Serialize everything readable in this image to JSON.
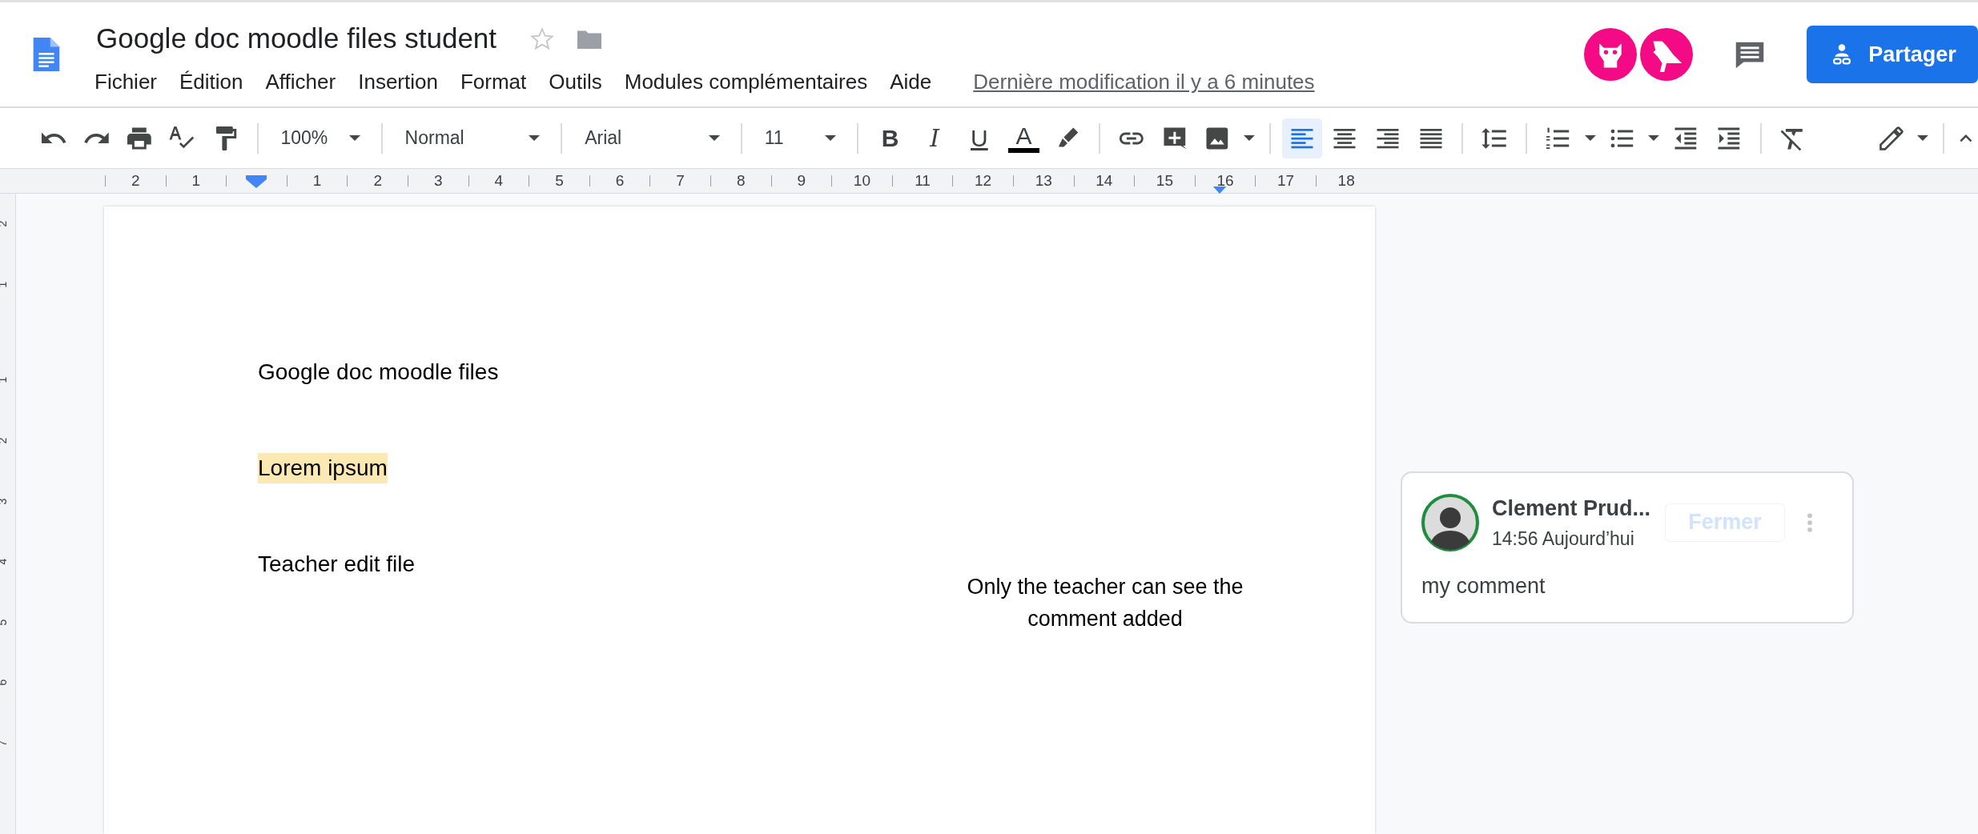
{
  "header": {
    "title": "Google doc moodle files student",
    "menu": [
      "Fichier",
      "Édition",
      "Afficher",
      "Insertion",
      "Format",
      "Outils",
      "Modules complémentaires",
      "Aide"
    ],
    "last_edit": "Dernière modification il y a 6 minutes",
    "share_button": "Partager"
  },
  "toolbar": {
    "zoom": "100%",
    "style": "Normal",
    "font": "Arial",
    "size": "11",
    "format": [
      {
        "kind": "bold",
        "label": "B"
      },
      {
        "kind": "italic",
        "label": "I"
      },
      {
        "kind": "underline",
        "label": "U"
      },
      {
        "kind": "color",
        "label": "A"
      }
    ],
    "alignment": [
      {
        "kind": "left",
        "selected": true
      },
      {
        "kind": "center",
        "selected": false
      },
      {
        "kind": "right",
        "selected": false
      },
      {
        "kind": "justify",
        "selected": false
      }
    ]
  },
  "ruler": {
    "left_labels": [
      "2",
      "1"
    ],
    "right_labels": [
      "1",
      "2",
      "3",
      "4",
      "5",
      "6",
      "7",
      "8",
      "9",
      "10",
      "11",
      "12",
      "13",
      "14",
      "15",
      "16",
      "17",
      "18"
    ]
  },
  "vertical_ruler": [
    "2",
    "1",
    "1",
    "2",
    "3",
    "4",
    "5",
    "6",
    "7"
  ],
  "document": {
    "paragraphs": [
      {
        "text": "Google doc moodle files",
        "highlighted": false
      },
      {
        "text": "Lorem ipsum",
        "highlighted": true
      },
      {
        "text": "Teacher edit file",
        "highlighted": false
      }
    ],
    "note": "Only the teacher can see the comment added"
  },
  "comment": {
    "author": "Clement Prud...",
    "time": "14:56 Aujourd’hui",
    "close_button": "Fermer",
    "close_disabled": true,
    "body": "my comment"
  }
}
